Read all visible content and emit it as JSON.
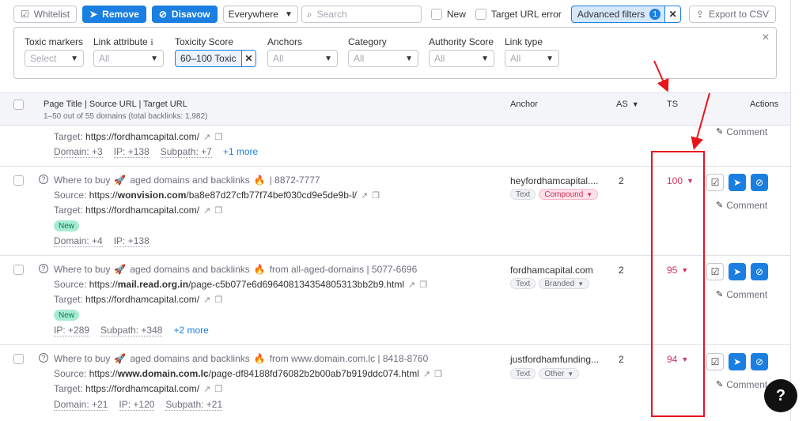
{
  "toolbar": {
    "whitelist": "Whitelist",
    "remove": "Remove",
    "disavow": "Disavow",
    "scope": "Everywhere",
    "search_placeholder": "Search",
    "new_label": "New",
    "target_error_label": "Target URL error",
    "advanced_label": "Advanced filters",
    "advanced_count": "1",
    "export": "Export to CSV"
  },
  "filters": {
    "toxic_markers": {
      "label": "Toxic markers",
      "value": "Select"
    },
    "link_attribute": {
      "label": "Link attribute",
      "value": "All"
    },
    "toxicity_score": {
      "label": "Toxicity Score",
      "value": "60–100 Toxic"
    },
    "anchors": {
      "label": "Anchors",
      "value": "All"
    },
    "category": {
      "label": "Category",
      "value": "All"
    },
    "authority_score": {
      "label": "Authority Score",
      "value": "All"
    },
    "link_type": {
      "label": "Link type",
      "value": "All"
    }
  },
  "table": {
    "col_page": "Page Title | Source URL | Target URL",
    "col_page_sub": "1–50 out of 55 domains (total backlinks: 1,982)",
    "col_anchor": "Anchor",
    "col_as": "AS",
    "col_ts": "TS",
    "col_actions": "Actions"
  },
  "partial_row": {
    "target_label": "Target:",
    "target": "https://fordhamcapital.com/",
    "domain": "Domain: +3",
    "ip": "IP: +138",
    "subpath": "Subpath: +7",
    "more": "+1 more",
    "comment": "Comment"
  },
  "rows": [
    {
      "title_pre": "Where to buy",
      "title_mid": "aged domains and backlinks",
      "title_post": "| 8872-7777",
      "source_label": "Source:",
      "source_pre": "https://",
      "source_bold": "wonvision.com",
      "source_post": "/ba8e87d27cfb77f74bef030cd9e5de9b-l/",
      "target_label": "Target:",
      "target": "https://fordhamcapital.com/",
      "new": "New",
      "meta1": "Domain: +4",
      "meta2": "IP: +138",
      "anchor": "heyfordhamcapital....",
      "tag1": "Text",
      "tag2": "Compound",
      "as": "2",
      "ts": "100",
      "comment": "Comment"
    },
    {
      "title_pre": "Where to buy",
      "title_mid": "aged domains and backlinks",
      "title_post": "from all-aged-domains | 5077-6696",
      "source_label": "Source:",
      "source_pre": "https://",
      "source_bold": "mail.read.org.in",
      "source_post": "/page-c5b077e6d696408134354805313bb2b9.html",
      "target_label": "Target:",
      "target": "https://fordhamcapital.com/",
      "new": "New",
      "meta1": "IP: +289",
      "meta2": "Subpath: +348",
      "more": "+2 more",
      "anchor": "fordhamcapital.com",
      "tag1": "Text",
      "tag2": "Branded",
      "as": "2",
      "ts": "95",
      "comment": "Comment"
    },
    {
      "title_pre": "Where to buy",
      "title_mid": "aged domains and backlinks",
      "title_post": "from www.domain.com.lc | 8418-8760",
      "source_label": "Source:",
      "source_pre": "https://",
      "source_bold": "www.domain.com.lc",
      "source_post": "/page-df84188fd76082b2b00ab7b919ddc074.html",
      "target_label": "Target:",
      "target": "https://fordhamcapital.com/",
      "meta1": "Domain: +21",
      "meta2": "IP: +120",
      "meta3": "Subpath: +21",
      "anchor": "justfordhamfunding...",
      "tag1": "Text",
      "tag2": "Other",
      "as": "2",
      "ts": "94",
      "comment": "Comment"
    }
  ],
  "help": "?"
}
